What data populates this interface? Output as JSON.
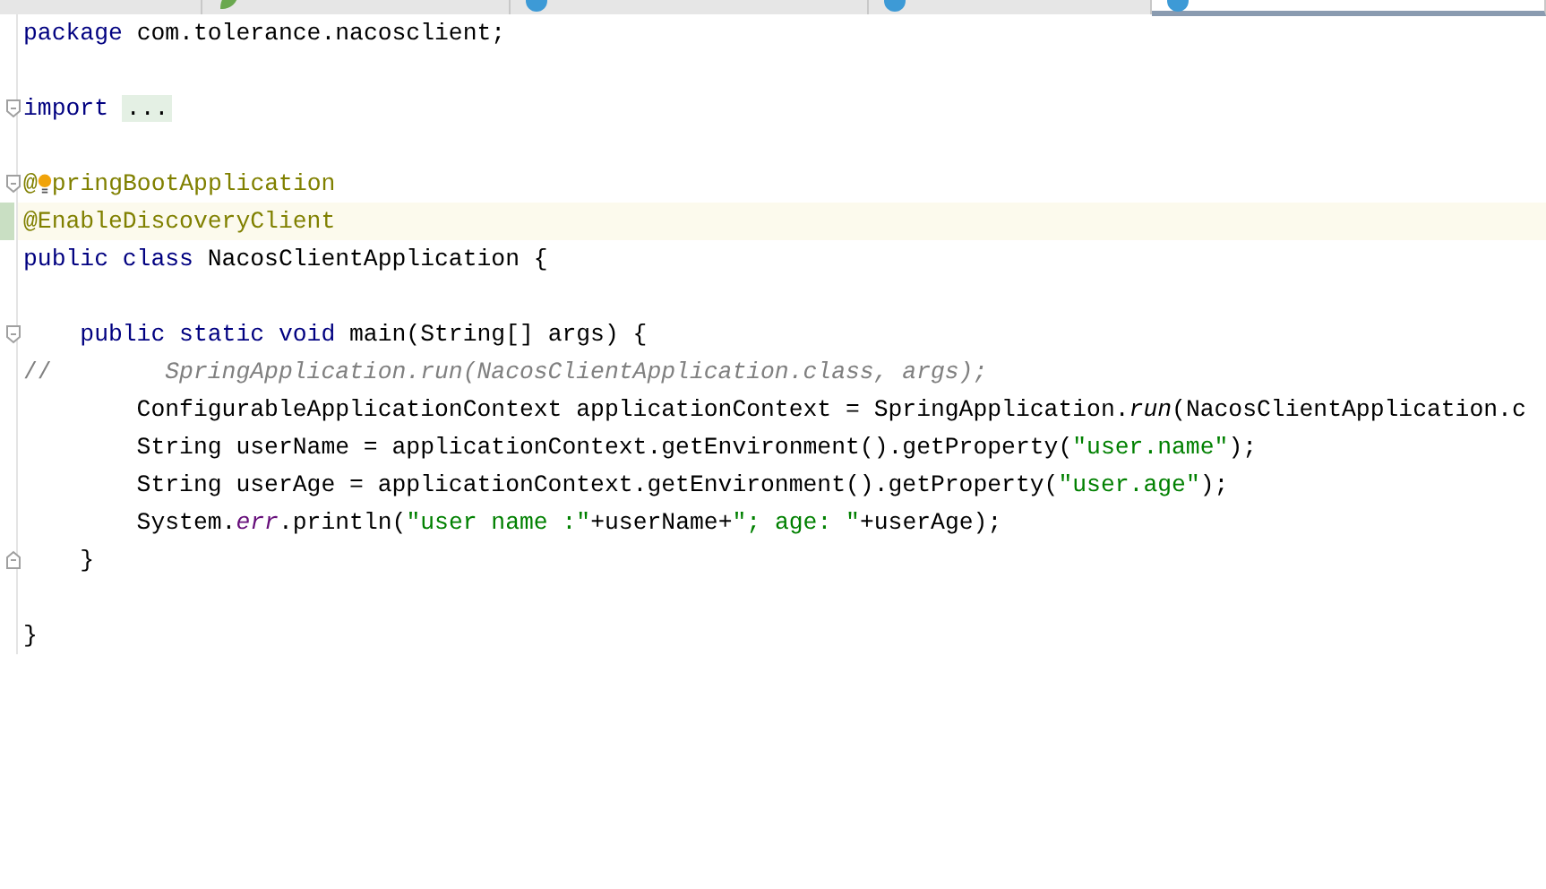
{
  "tabs": [
    {
      "kind": "file",
      "selected": false
    },
    {
      "kind": "properties",
      "selected": false
    },
    {
      "kind": "class",
      "selected": false
    },
    {
      "kind": "class",
      "selected": false
    },
    {
      "kind": "class",
      "selected": true
    }
  ],
  "lines": [
    {
      "highlighted": false,
      "tokens": [
        {
          "kind": "keyword",
          "text": "package"
        },
        {
          "kind": "plain",
          "text": " com.tolerance.nacosclient;"
        }
      ]
    },
    {
      "highlighted": false
    },
    {
      "fold_start": true,
      "highlighted": false,
      "tokens": [
        {
          "kind": "keyword",
          "text": "import "
        },
        {
          "kind": "folded",
          "text": "..."
        }
      ]
    },
    {
      "highlighted": false
    },
    {
      "fold_start": true,
      "highlighted": false,
      "tokens": [
        {
          "kind": "annotation",
          "text": "@"
        },
        {
          "kind": "bulb"
        },
        {
          "kind": "annotation",
          "text": "pringBootApplication"
        }
      ]
    },
    {
      "highlighted": true,
      "changed": true,
      "tokens": [
        {
          "kind": "annotation",
          "text": "@EnableDiscoveryClient"
        }
      ]
    },
    {
      "highlighted": false,
      "tokens": [
        {
          "kind": "keyword",
          "text": "public class"
        },
        {
          "kind": "plain",
          "text": " NacosClientApplication {"
        }
      ]
    },
    {
      "highlighted": false
    },
    {
      "fold_start": true,
      "highlighted": false,
      "tokens": [
        {
          "kind": "keyword",
          "text": "    public static void"
        },
        {
          "kind": "plain",
          "text": " main(String[] args) {"
        }
      ]
    },
    {
      "highlighted": false,
      "tokens": [
        {
          "kind": "comment",
          "text": "//"
        },
        {
          "kind": "comment-italic",
          "text": "        SpringApplication.run(NacosClientApplication.class, args);"
        }
      ]
    },
    {
      "highlighted": false,
      "tokens": [
        {
          "kind": "plain",
          "text": "        ConfigurableApplicationContext applicationContext = SpringApplication."
        },
        {
          "kind": "italic",
          "text": "run"
        },
        {
          "kind": "plain",
          "text": "(NacosClientApplication.c"
        }
      ]
    },
    {
      "highlighted": false,
      "tokens": [
        {
          "kind": "plain",
          "text": "        String userName = applicationContext.getEnvironment().getProperty("
        },
        {
          "kind": "string",
          "text": "\"user.name\""
        },
        {
          "kind": "plain",
          "text": ");"
        }
      ]
    },
    {
      "highlighted": false,
      "tokens": [
        {
          "kind": "plain",
          "text": "        String userAge = applicationContext.getEnvironment().getProperty("
        },
        {
          "kind": "string",
          "text": "\"user.age\""
        },
        {
          "kind": "plain",
          "text": ");"
        }
      ]
    },
    {
      "highlighted": false,
      "tokens": [
        {
          "kind": "plain",
          "text": "        System."
        },
        {
          "kind": "field",
          "text": "err"
        },
        {
          "kind": "plain",
          "text": ".println("
        },
        {
          "kind": "string",
          "text": "\"user name :\""
        },
        {
          "kind": "plain",
          "text": "+userName+"
        },
        {
          "kind": "string",
          "text": "\"; age: \""
        },
        {
          "kind": "plain",
          "text": "+userAge);"
        }
      ]
    },
    {
      "fold_end": true,
      "highlighted": false,
      "tokens": [
        {
          "kind": "plain",
          "text": "    }"
        }
      ]
    },
    {
      "highlighted": false
    },
    {
      "highlighted": false,
      "tokens": [
        {
          "kind": "plain",
          "text": "}"
        }
      ]
    }
  ]
}
